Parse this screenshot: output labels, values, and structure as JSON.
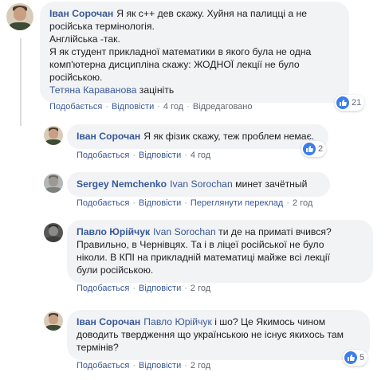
{
  "comments": [
    {
      "author": "Іван Сорочан",
      "lines": [
        "Я як с++ дев скажу. Хуйня на палицці а не",
        "російська термінологія.",
        "Англійська -так.",
        "Я як студент прикладної математики в якого була не одна",
        "комп'ютерна дисципліна скажу: ЖОДНОЇ лекції не було",
        "російською."
      ],
      "mention": "Тетяна Караванова",
      "mention_suffix": " зацініть",
      "actions": {
        "like": "Подобається",
        "reply": "Відповісти",
        "time": "4 год",
        "edited": "Відредаговано"
      },
      "reactions": "21"
    },
    {
      "author": "Іван Сорочан",
      "text": "Я як фізик скажу, теж проблем немає.",
      "actions": {
        "like": "Подобається",
        "reply": "Відповісти",
        "time": "4 год"
      },
      "reactions": "2"
    },
    {
      "author": "Sergey Nemchenko",
      "mention": "Ivan Sorochan",
      "text": " минет зачётный",
      "actions": {
        "like": "Подобається",
        "reply": "Відповісти",
        "translate": "Переглянути переклад",
        "time": "2 год"
      }
    },
    {
      "author": "Павло Юрійчук",
      "mention": "Ivan Sorochan",
      "lines": [
        " ти де на приматі вчився?",
        "Правильно, в Чернівцях. Та і в ліцеї російської не було",
        "ніколи. В КПІ на прикладній математиці майже всі лекції",
        "були російською."
      ],
      "actions": {
        "like": "Подобається",
        "reply": "Відповісти",
        "time": "2 год"
      }
    },
    {
      "author": "Іван Сорочан",
      "mention": "Павло Юрійчук",
      "lines": [
        " і шо? Це Якимось чином",
        "доводить твердження що українською не існує якихось там",
        "термінів?"
      ],
      "actions": {
        "like": "Подобається",
        "reply": "Відповісти",
        "time": "2 год"
      },
      "reactions": "5"
    }
  ],
  "icons": {
    "like": "like-thumbs-up-icon"
  },
  "colors": {
    "link": "#385898",
    "bubble": "#f2f3f5",
    "like_blue": "#3b7ded",
    "meta": "#606770"
  }
}
